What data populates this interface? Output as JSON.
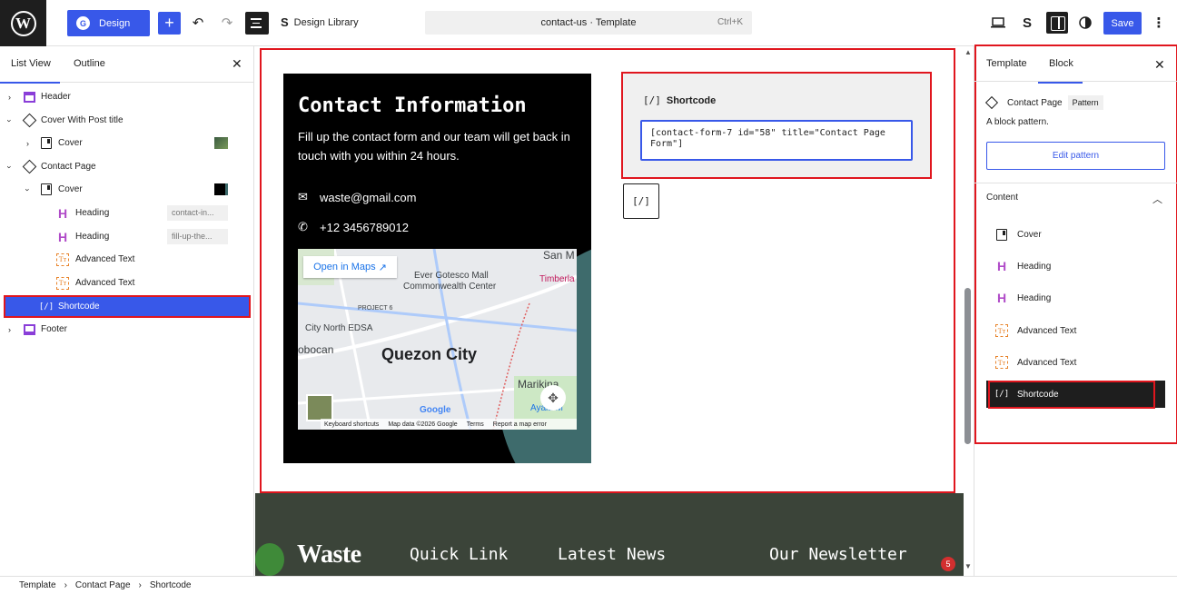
{
  "topbar": {
    "design_label": "Design",
    "design_library_label": "Design Library",
    "command_title": "contact-us · Template",
    "command_shortcut": "Ctrl+K",
    "save_label": "Save"
  },
  "left_panel": {
    "tabs": [
      "List View",
      "Outline"
    ],
    "active_tab": "List View",
    "tree": [
      {
        "label": "Header",
        "icon": "header-icon",
        "depth": 0,
        "expandable": true,
        "expanded": false
      },
      {
        "label": "Cover With Post title",
        "icon": "pattern-icon",
        "depth": 0,
        "expandable": true,
        "expanded": true
      },
      {
        "label": "Cover",
        "icon": "cover-icon",
        "depth": 1,
        "expandable": true,
        "expanded": false
      },
      {
        "label": "Contact Page",
        "icon": "pattern-icon",
        "depth": 0,
        "expandable": true,
        "expanded": true
      },
      {
        "label": "Cover",
        "icon": "cover-icon",
        "depth": 1,
        "expandable": true,
        "expanded": true
      },
      {
        "label": "Heading",
        "icon": "heading-icon",
        "depth": 2,
        "tag": "contact-in..."
      },
      {
        "label": "Heading",
        "icon": "heading-icon",
        "depth": 2,
        "tag": "fill-up-the..."
      },
      {
        "label": "Advanced Text",
        "icon": "advanced-text-icon",
        "depth": 2
      },
      {
        "label": "Advanced Text",
        "icon": "advanced-text-icon",
        "depth": 2
      },
      {
        "label": "Shortcode",
        "icon": "shortcode-icon",
        "depth": 1,
        "selected": true
      },
      {
        "label": "Footer",
        "icon": "footer-icon",
        "depth": 0,
        "expandable": true,
        "expanded": false
      }
    ]
  },
  "canvas": {
    "contact_title": "Contact Information",
    "contact_desc": "Fill up the contact form and our team will get back in touch with you within 24 hours.",
    "email": "waste@gmail.com",
    "phone": "+12 3456789012",
    "map": {
      "open_label": "Open in Maps",
      "city": "Quezon City",
      "places": [
        "Ever Gotesco Mall",
        "Commonwealth Center",
        "City North EDSA",
        "PROJECT 6",
        "Marikina",
        "San M",
        "Timberla",
        "obocan",
        "Ayala M"
      ],
      "footer": [
        "Keyboard shortcuts",
        "Map data ©2026 Google",
        "Terms",
        "Report a map error"
      ],
      "google": "Google"
    },
    "shortcode_label": "Shortcode",
    "shortcode_value": "[contact-form-7 id=\"58\" title=\"Contact Page Form\"]",
    "footer_headings": [
      "Quick Link",
      "Latest News",
      "Our Newsletter"
    ],
    "footer_logo": "Waste",
    "notification_count": "5"
  },
  "right_panel": {
    "tabs": [
      "Template",
      "Block"
    ],
    "active_tab": "Block",
    "pattern_name": "Contact Page",
    "pattern_tag": "Pattern",
    "pattern_desc": "A block pattern.",
    "edit_label": "Edit pattern",
    "content_heading": "Content",
    "content_items": [
      "Cover",
      "Heading",
      "Heading",
      "Advanced Text",
      "Advanced Text",
      "Shortcode"
    ]
  },
  "breadcrumb": [
    "Template",
    "Contact Page",
    "Shortcode"
  ],
  "colors": {
    "accent": "#3858e9",
    "highlight_red": "#e0161e",
    "footer_bg": "#3b4439",
    "cover_circle": "#3e6b6c"
  }
}
